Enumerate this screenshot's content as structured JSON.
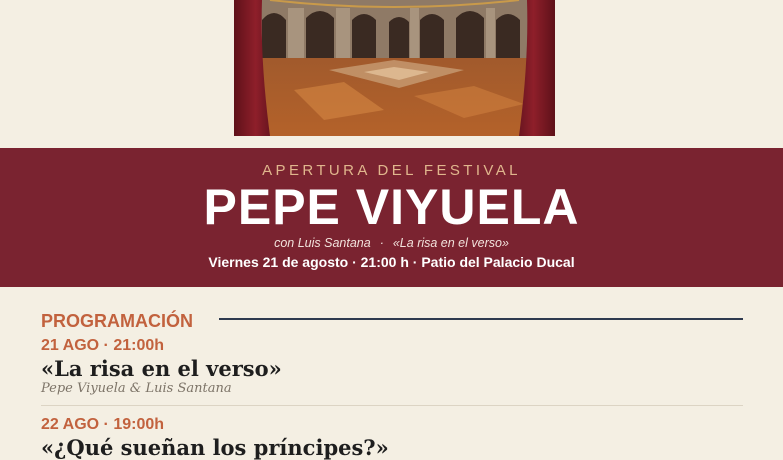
{
  "hero": {
    "image_description_icon": "courtyard-stage-photo"
  },
  "banner": {
    "kicker": "APERTURA DEL FESTIVAL",
    "headline": "PEPE VIYUELA",
    "with": "con Luis Santana",
    "separator": "·",
    "show_title": "«La risa en el verso»",
    "details": "Viernes 21 de agosto · 21:00 h · Patio del Palacio Ducal"
  },
  "program": {
    "title": "PROGRAMACIÓN",
    "events": [
      {
        "when": "21 AGO · 21:00h",
        "name": "«La risa en el verso»",
        "artists": "Pepe Viyuela & Luis Santana"
      },
      {
        "when": "22 AGO · 19:00h",
        "name": "«¿Qué sueñan los príncipes?»",
        "artists": ""
      }
    ]
  },
  "colors": {
    "banner": "#7a2330",
    "accent": "#c2623e",
    "background": "#f4efe3",
    "rule": "#2e3a4f"
  }
}
